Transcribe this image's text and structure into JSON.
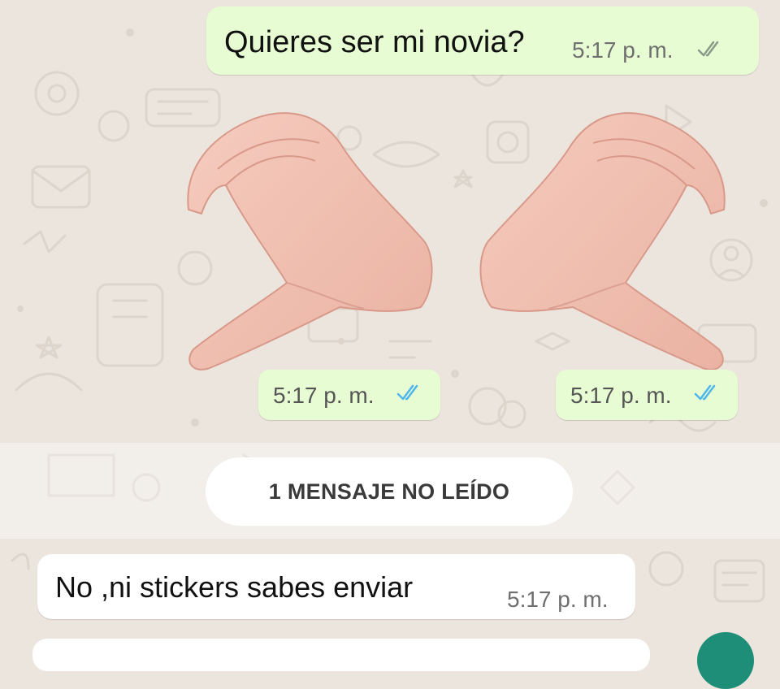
{
  "messages": {
    "outgoing_text": "Quieres ser mi novia?",
    "outgoing_time": "5:17 p. m.",
    "sticker_left_time": "5:17 p. m.",
    "sticker_right_time": "5:17 p. m.",
    "incoming_text": "No ,ni stickers sabes enviar",
    "incoming_time": "5:17 p. m."
  },
  "unread_banner": "1 MENSAJE NO LEÍDO",
  "colors": {
    "wallpaper": "#ece5dd",
    "outgoing_bubble": "#e7fcd3",
    "incoming_bubble": "#ffffff",
    "read_ticks": "#4fb6ec",
    "fab": "#1e8e78"
  },
  "icons": [
    "double-check-icon",
    "hand-heart-sticker-left",
    "hand-heart-sticker-right"
  ]
}
